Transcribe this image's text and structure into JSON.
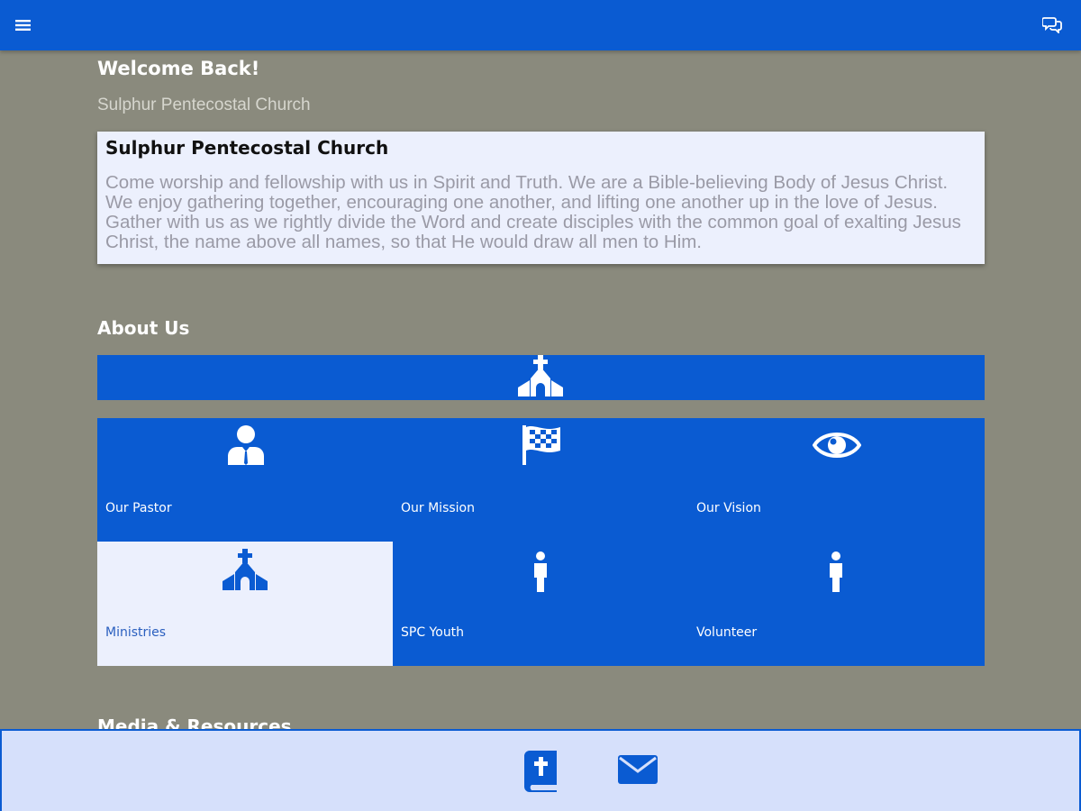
{
  "header": {
    "menu_icon": "hamburger-menu-icon",
    "chat_icon": "chat-bubbles-icon"
  },
  "welcome": {
    "heading": "Welcome Back!",
    "subheading": "Sulphur Pentecostal Church"
  },
  "intro_card": {
    "title": "Sulphur Pentecostal Church",
    "body": "Come worship and fellowship with us in Spirit and Truth. We are a Bible-believing Body of Jesus Christ. We enjoy gathering together, encouraging one another, and lifting one another up in the love of Jesus. Gather with us as we rightly divide the Word and create disciples with the common goal of exalting Jesus Christ, the name above all names, so that He would draw all men to Him."
  },
  "about": {
    "title": "About Us",
    "banner_icon": "church-icon",
    "tiles": [
      {
        "label": "Our Pastor",
        "icon": "pastor-icon"
      },
      {
        "label": "Our Mission",
        "icon": "checkered-flag-icon"
      },
      {
        "label": "Our Vision",
        "icon": "eye-icon"
      },
      {
        "label": "Ministries",
        "icon": "church-icon"
      },
      {
        "label": "SPC Youth",
        "icon": "person-icon"
      },
      {
        "label": "Volunteer",
        "icon": "person-icon"
      }
    ]
  },
  "media": {
    "title": "Media & Resources"
  },
  "bottom_nav": {
    "items": [
      {
        "icon": "bible-icon"
      },
      {
        "icon": "envelope-icon"
      }
    ]
  },
  "colors": {
    "primary": "#0a5bd2",
    "background": "#8a8a7d",
    "card": "#ecf0fd",
    "bottom_bar": "#d6e0fb"
  }
}
